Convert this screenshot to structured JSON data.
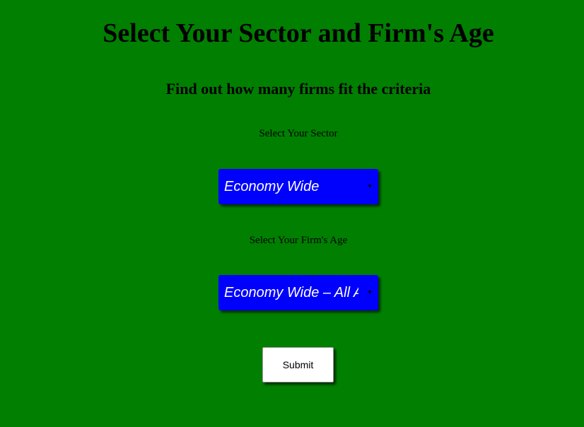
{
  "page": {
    "title": "Select Your Sector and Firm's Age",
    "subtitle": "Find out how many firms fit the criteria"
  },
  "form": {
    "sector_label": "Select Your Sector",
    "sector_selected": "Economy Wide",
    "age_label": "Select Your Firm's Age",
    "age_selected": "Economy Wide – All Ages",
    "submit_label": "Submit"
  },
  "icons": {
    "dropdown_arrow": "chevron-down-icon"
  },
  "colors": {
    "background": "#017f01",
    "select_background": "#0000fd",
    "select_text": "#ffffff",
    "button_background": "#ffffff"
  }
}
